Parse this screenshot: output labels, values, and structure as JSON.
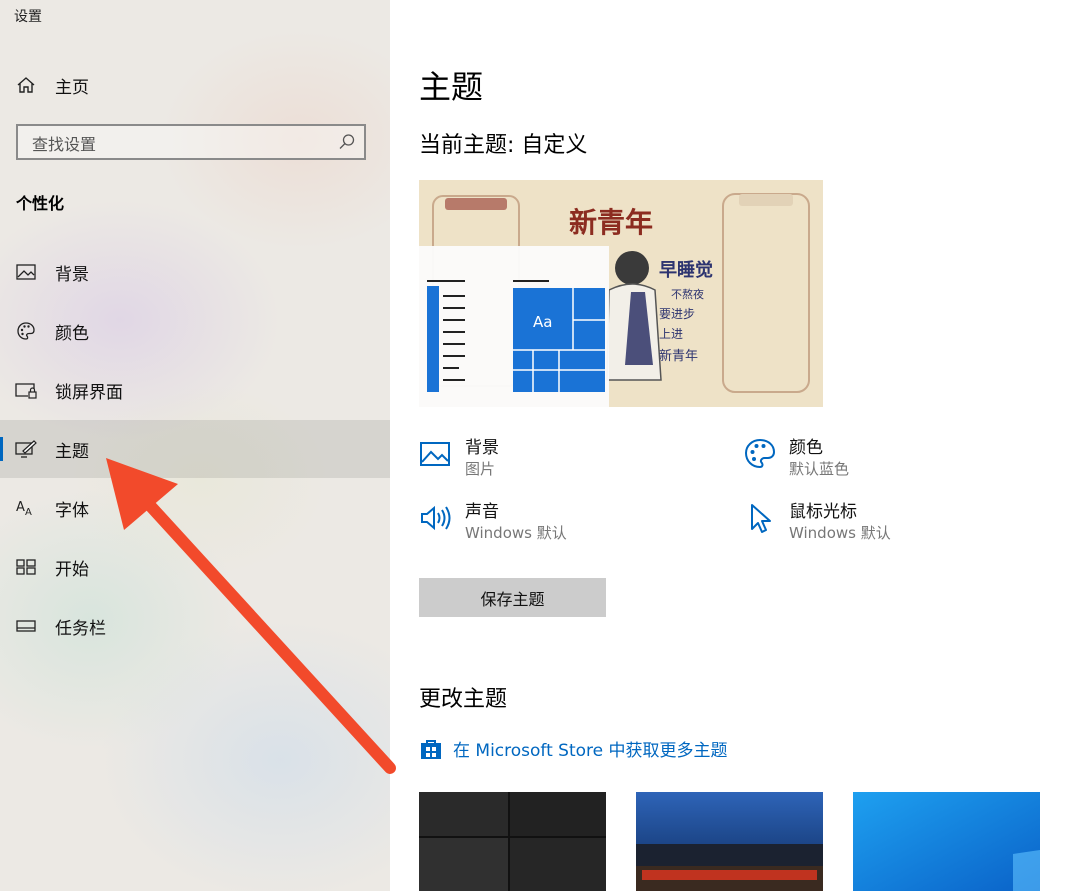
{
  "window": {
    "title": "设置"
  },
  "sidebar": {
    "home_label": "主页",
    "search_placeholder": "查找设置",
    "section_title": "个性化",
    "items": [
      {
        "label": "背景",
        "icon": "picture-icon"
      },
      {
        "label": "颜色",
        "icon": "palette-icon"
      },
      {
        "label": "锁屏界面",
        "icon": "lock-screen-icon"
      },
      {
        "label": "主题",
        "icon": "theme-brush-icon",
        "active": true
      },
      {
        "label": "字体",
        "icon": "font-icon"
      },
      {
        "label": "开始",
        "icon": "start-icon"
      },
      {
        "label": "任务栏",
        "icon": "taskbar-icon"
      }
    ]
  },
  "main": {
    "title": "主题",
    "current_theme": "当前主题: 自定义",
    "preview": {
      "headline": "新青年",
      "subheadline": "早睡觉",
      "lines": [
        "不熬夜",
        "要进步",
        "上进",
        "新青年"
      ],
      "tile_text": "Aa"
    },
    "attributes": {
      "background": {
        "name": "背景",
        "value": "图片"
      },
      "color": {
        "name": "颜色",
        "value": "默认蓝色"
      },
      "sound": {
        "name": "声音",
        "value": "Windows 默认"
      },
      "cursor": {
        "name": "鼠标光标",
        "value": "Windows 默认"
      }
    },
    "save_button": "保存主题",
    "change_title": "更改主题",
    "store_link": "在 Microsoft Store 中获取更多主题"
  },
  "colors": {
    "accent": "#0067c0",
    "arrow": "#f24a2b",
    "active_row": "#dcdad5"
  }
}
